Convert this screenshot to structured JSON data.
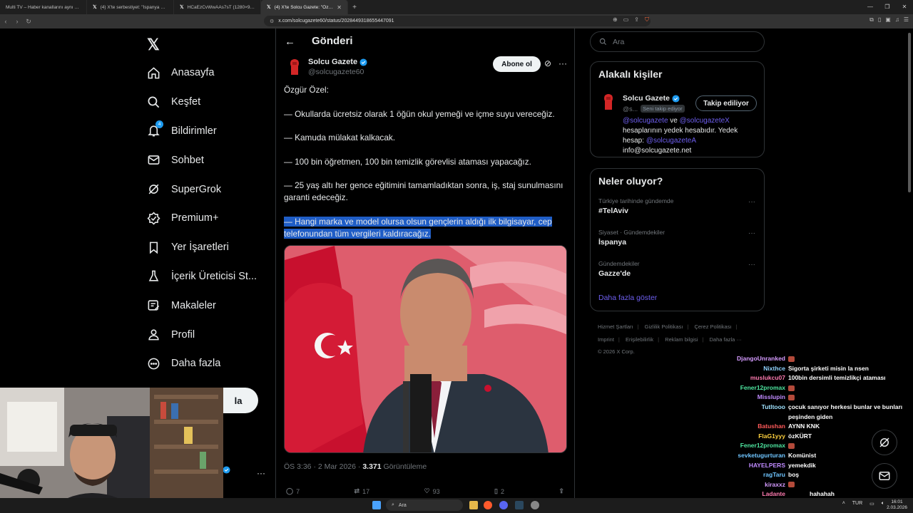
{
  "browser": {
    "tabs": [
      {
        "label": "Multi TV – Haber kanallarını aynı and",
        "icon": "tv-icon"
      },
      {
        "label": "(4) X'te serbestiyet: \"İspanya Başbak",
        "icon": "x-logo-icon"
      },
      {
        "label": "HCaEzCvWwAAs7sT (1280×960)",
        "icon": "x-logo-icon"
      },
      {
        "label": "(4) X'te Solcu Gazete: \"Özgür Ö",
        "icon": "x-logo-icon",
        "active": true
      }
    ],
    "url": "x.com/solcugazete60/status/2028449318655447091"
  },
  "nav": {
    "items": [
      {
        "label": "Anasayfa",
        "icon": "home-icon"
      },
      {
        "label": "Keşfet",
        "icon": "search-icon"
      },
      {
        "label": "Bildirimler",
        "icon": "bell-icon",
        "badge": "4"
      },
      {
        "label": "Sohbet",
        "icon": "mail-icon"
      },
      {
        "label": "SuperGrok",
        "icon": "grok-icon"
      },
      {
        "label": "Premium+",
        "icon": "verified-icon"
      },
      {
        "label": "Yer İşaretleri",
        "icon": "bookmark-icon"
      },
      {
        "label": "İçerik Üreticisi St...",
        "icon": "flask-icon"
      },
      {
        "label": "Makaleler",
        "icon": "article-icon"
      },
      {
        "label": "Profil",
        "icon": "person-icon"
      },
      {
        "label": "Daha fazla",
        "icon": "more-circle-icon"
      }
    ],
    "post_button": "la"
  },
  "main": {
    "header_title": "Gönderi",
    "author_name": "Solcu Gazete",
    "author_handle": "@solcugazete60",
    "subscribe_label": "Abone ol",
    "paragraphs": [
      "Özgür Özel:",
      "— Okullarda ücretsiz olarak 1 öğün okul yemeği ve içme suyu vereceğiz.",
      "— Kamuda mülakat kalkacak.",
      "— 100 bin öğretmen, 100 bin temizlik görevlisi ataması yapacağız.",
      "— 25 yaş altı her gence eğitimini tamamladıktan sonra, iş, staj sunulmasını garanti edeceğiz.",
      "— Hangi marka ve model olursa olsun gençlerin aldığı ilk bilgisayar, cep telefonundan tüm vergileri kaldıracağız."
    ],
    "time": "ÖS 3:36 · 2 Mar 2026 · ",
    "views": "3.371",
    "views_label": "Görüntüleme",
    "actions": {
      "reply": "7",
      "retweet": "17",
      "like": "93",
      "bookmark": "2"
    }
  },
  "right": {
    "search_placeholder": "Ara",
    "related_title": "Alakalı kişiler",
    "related": {
      "name": "Solcu Gazete",
      "handle": "@s...",
      "follows_you": "Seni takip ediyor",
      "follow_button": "Takip ediliyor",
      "bio_link1": "@solcugazete",
      "bio_ve": " ve ",
      "bio_link2": "@solcugazeteX",
      "bio_mid": " hesaplarının yedek hesabıdır. Yedek hesap: ",
      "bio_link3": "@solcugazeteA",
      "bio_email": "info@solcugazete.net"
    },
    "trends_title": "Neler oluyor?",
    "trends": [
      {
        "category": "Türkiye tarihinde gündemde",
        "name": "#TelAviv"
      },
      {
        "category": "Siyaset · Gündemdekiler",
        "name": "İspanya"
      },
      {
        "category": "Gündemdekiler",
        "name": "Gazze'de"
      }
    ],
    "show_more": "Daha fazla göster",
    "footer": [
      "Hizmet Şartları",
      "Gizlilik Politikası",
      "Çerez Politikası",
      "Imprint",
      "Erişilebilirlik",
      "Reklam bilgisi",
      "Daha fazla ···"
    ],
    "copyright": "© 2026 X Corp."
  },
  "chat": [
    {
      "user": "DjangoUnranked",
      "color": "#d59bff",
      "text": "",
      "emote": true
    },
    {
      "user": "Nixthce",
      "color": "#8fd3ff",
      "text": "Sigorta şirketi misin la nsen"
    },
    {
      "user": "muslukcu07",
      "color": "#ff7bb0",
      "text": "100bin dersimli temizlikçi ataması"
    },
    {
      "user": "Fener12promax",
      "color": "#4ee6a0",
      "text": "",
      "emote": true
    },
    {
      "user": "Misslupin",
      "color": "#c08bff",
      "text": "",
      "emote": true
    },
    {
      "user": "Tutltooo",
      "color": "#9fe2ff",
      "text": "çocuk sanıyor herkesi bunlar ve bunları peşinden giden"
    },
    {
      "user": "Batushan",
      "color": "#ff5a5a",
      "text": "AYNN KNK"
    },
    {
      "user": "FlaG1yyy",
      "color": "#ffd23f",
      "text": "özKÜRT"
    },
    {
      "user": "Fener12promax",
      "color": "#4ee6a0",
      "text": "",
      "emote": true
    },
    {
      "user": "sevketugurturan",
      "color": "#6fc5ff",
      "text": "Komünist"
    },
    {
      "user": "HAYELPERS",
      "color": "#c08bff",
      "text": "yemekdik"
    },
    {
      "user": "ragTaru",
      "color": "#6fc5ff",
      "text": "boş"
    },
    {
      "user": "kiraxxz",
      "color": "#d59bff",
      "text": "",
      "emote": true
    },
    {
      "user": "Ladante",
      "color": "#ff7bb0",
      "text": "hahahah"
    }
  ],
  "taskbar": {
    "search": "Ara",
    "lang": "TUR",
    "time": "16:01",
    "date": "2.03.2026"
  }
}
